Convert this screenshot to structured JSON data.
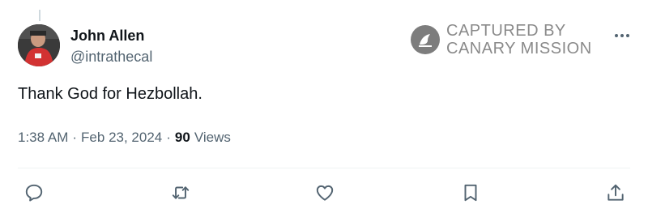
{
  "tweet": {
    "author": {
      "display_name": "John Allen",
      "handle": "@intrathecal",
      "avatar": "avatar-photo"
    },
    "text": "Thank God for Hezbollah.",
    "time": "1:38 AM",
    "date": "Feb 23, 2024",
    "views_count": "90",
    "views_label": "Views"
  },
  "watermark": {
    "line1": "CAPTURED BY",
    "line2": "CANARY MISSION",
    "icon": "canary-bird-icon"
  },
  "actions": [
    {
      "name": "reply",
      "icon": "reply-icon"
    },
    {
      "name": "retweet",
      "icon": "retweet-icon"
    },
    {
      "name": "like",
      "icon": "heart-icon"
    },
    {
      "name": "bookmark",
      "icon": "bookmark-icon"
    },
    {
      "name": "share",
      "icon": "share-icon"
    }
  ],
  "colors": {
    "text_primary": "#0f1419",
    "text_secondary": "#536471",
    "watermark": "#8a8a8a",
    "divider": "#eff3f4"
  }
}
